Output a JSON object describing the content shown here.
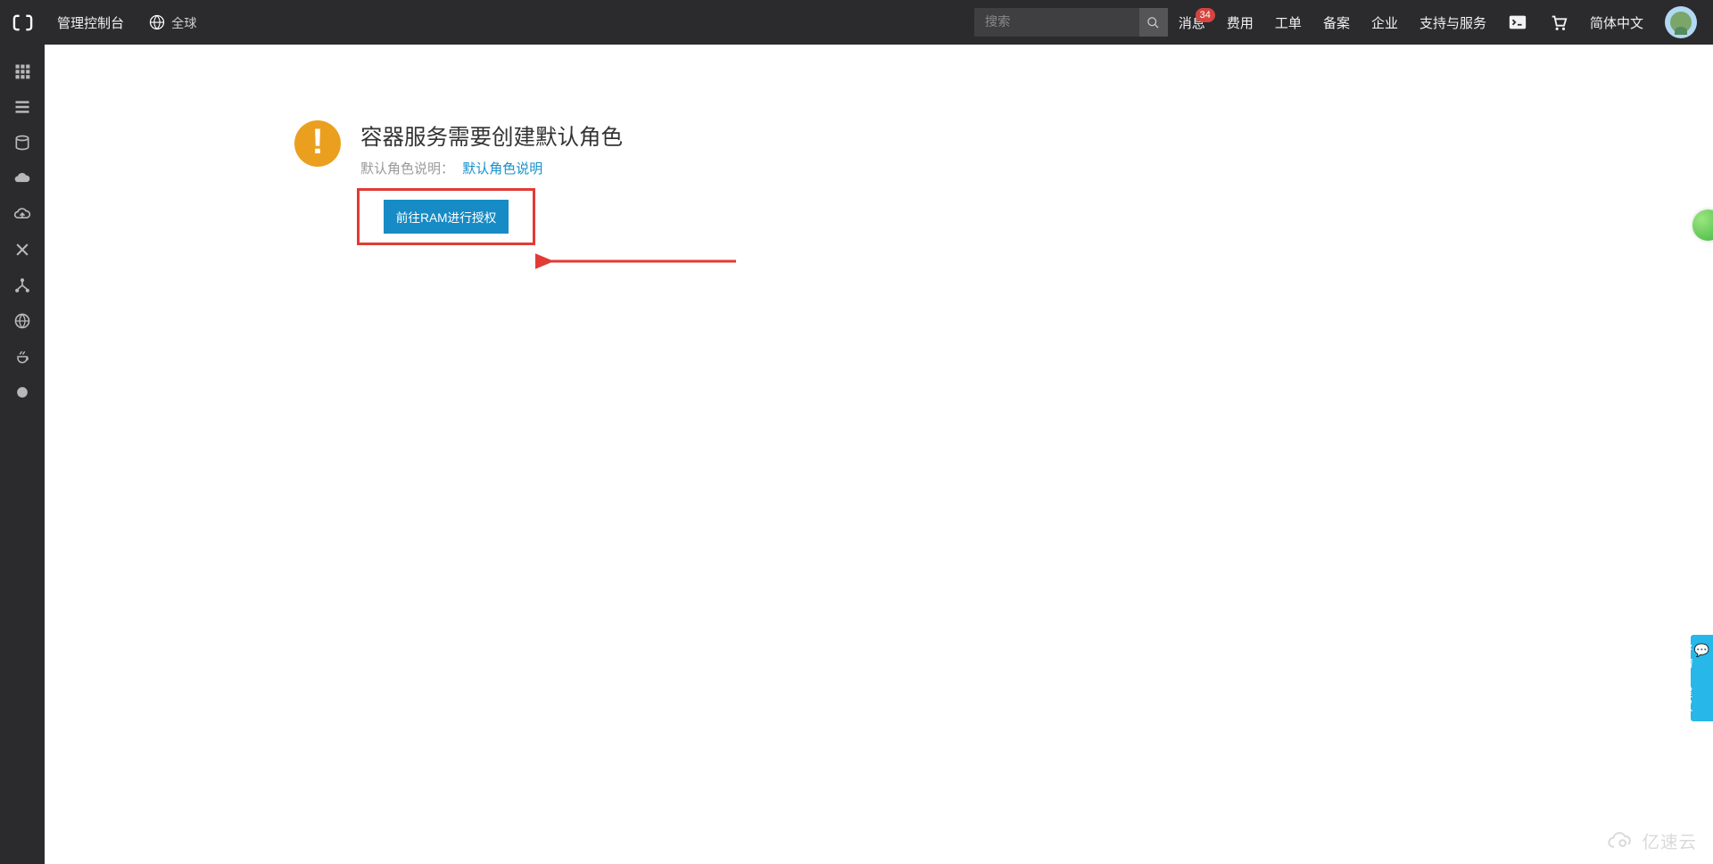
{
  "topbar": {
    "console_title": "管理控制台",
    "region_label": "全球",
    "search_placeholder": "搜索",
    "nav": {
      "messages": "消息",
      "messages_badge": "34",
      "fees": "费用",
      "tickets": "工单",
      "filing": "备案",
      "enterprise": "企业",
      "support": "支持与服务",
      "language": "简体中文"
    },
    "cloudshell_tip": "云命令行（Cloud Shell）"
  },
  "notice": {
    "title": "容器服务需要创建默认角色",
    "sub_label": "默认角色说明：",
    "sub_link": "默认角色说明",
    "button_label": "前往RAM进行授权"
  },
  "feedback": "咨询·建议",
  "watermark": "亿速云"
}
